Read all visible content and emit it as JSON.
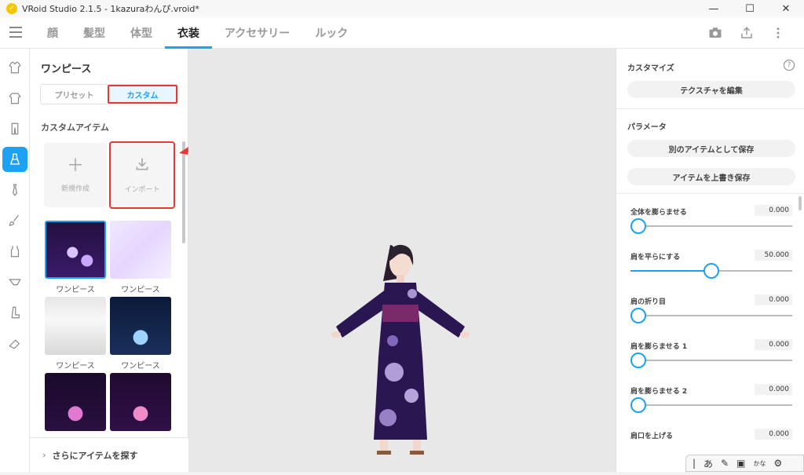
{
  "titlebar": {
    "title": "VRoid Studio 2.1.5 - 1kazuraわんぴ.vroid*",
    "minimize": "—",
    "maximize": "☐",
    "close": "✕"
  },
  "topnav": {
    "tabs": [
      {
        "label": "顔",
        "active": false
      },
      {
        "label": "髪型",
        "active": false
      },
      {
        "label": "体型",
        "active": false
      },
      {
        "label": "衣装",
        "active": true
      },
      {
        "label": "アクセサリー",
        "active": false
      },
      {
        "label": "ルック",
        "active": false
      }
    ],
    "icons": [
      "camera-icon",
      "export-icon",
      "more-icon"
    ]
  },
  "iconrail": {
    "items": [
      "shirt-icon",
      "tshirt-icon",
      "pants-icon",
      "onepiece-icon",
      "tie-icon",
      "brush-icon",
      "tank-icon",
      "underwear-icon",
      "boots-icon",
      "shoes-icon"
    ],
    "active_index": 3
  },
  "left": {
    "title": "ワンピース",
    "segment": {
      "preset": "プリセット",
      "custom": "カスタム"
    },
    "subheading": "カスタムアイテム",
    "new_label": "新規作成",
    "import_label": "インポート",
    "items": [
      {
        "caption": "ワンピース",
        "selected": true
      },
      {
        "caption": "ワンピース",
        "selected": false
      },
      {
        "caption": "ワンピース",
        "selected": false
      },
      {
        "caption": "ワンピース",
        "selected": false
      },
      {
        "caption": "",
        "selected": false
      },
      {
        "caption": "",
        "selected": false
      }
    ],
    "footer": "さらにアイテムを探す"
  },
  "right": {
    "customize": "カスタマイズ",
    "edit_texture": "テクスチャを編集",
    "parameters": "パラメータ",
    "save_as_new": "別のアイテムとして保存",
    "overwrite": "アイテムを上書き保存",
    "sliders": [
      {
        "label": "全体を膨らませる",
        "value": "0.000",
        "pos": 0.0
      },
      {
        "label": "肩を平らにする",
        "value": "50.000",
        "pos": 0.5
      },
      {
        "label": "肩の折り目",
        "value": "0.000",
        "pos": 0.0
      },
      {
        "label": "肩を膨らませる 1",
        "value": "0.000",
        "pos": 0.0
      },
      {
        "label": "肩を膨らませる 2",
        "value": "0.000",
        "pos": 0.0
      },
      {
        "label": "肩口を上げる",
        "value": "0.000",
        "pos": 0.0
      }
    ]
  },
  "ime": {
    "mode": "あ",
    "extra": "かな"
  },
  "colors": {
    "accent": "#1da1f2",
    "highlight": "#e53935",
    "kimono": "#2a1650",
    "obi": "#7a2a6a"
  }
}
